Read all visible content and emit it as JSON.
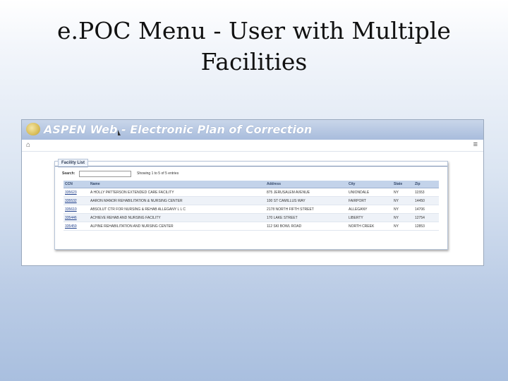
{
  "slide": {
    "title_line1": "e.POC Menu - User with Multiple",
    "title_line2": "Facilities"
  },
  "app": {
    "title": "ASPEN Web - Electronic Plan of Correction"
  },
  "icons": {
    "home": "⌂",
    "menu": "≡"
  },
  "panel": {
    "tab_label": "Facility List",
    "search_label": "Search:",
    "search_value": "",
    "showing_text": "Showing 1 to 5 of 5 entries"
  },
  "table": {
    "headers": {
      "ccn": "CCN",
      "name": "Name",
      "address": "Address",
      "city": "City",
      "state": "State",
      "zip": "Zip"
    },
    "rows": [
      {
        "ccn": "335623",
        "name": "A HOLLY PATTERSON EXTENDED CARE FACILITY",
        "address": "875 JERUSALEM AVENUE",
        "city": "UNIONDALE",
        "state": "NY",
        "zip": "11553"
      },
      {
        "ccn": "335532",
        "name": "AARON MANOR REHABILITATION & NURSING CENTER",
        "address": "100 ST CAMILLUS WAY",
        "city": "FAIRPORT",
        "state": "NY",
        "zip": "14450"
      },
      {
        "ccn": "335610",
        "name": "ABSOLUT CTR FOR NURSING & REHAB ALLEGANY L L C",
        "address": "2178 NORTH FIFTH STREET",
        "city": "ALLEGANY",
        "state": "NY",
        "zip": "14706"
      },
      {
        "ccn": "335446",
        "name": "ACHIEVE REHAB AND NURSING FACILITY",
        "address": "170 LAKE STREET",
        "city": "LIBERTY",
        "state": "NY",
        "zip": "12754"
      },
      {
        "ccn": "335459",
        "name": "ALPINE REHABILITATION AND NURSING CENTER",
        "address": "112 SKI BOWL ROAD",
        "city": "NORTH CREEK",
        "state": "NY",
        "zip": "12853"
      }
    ]
  }
}
